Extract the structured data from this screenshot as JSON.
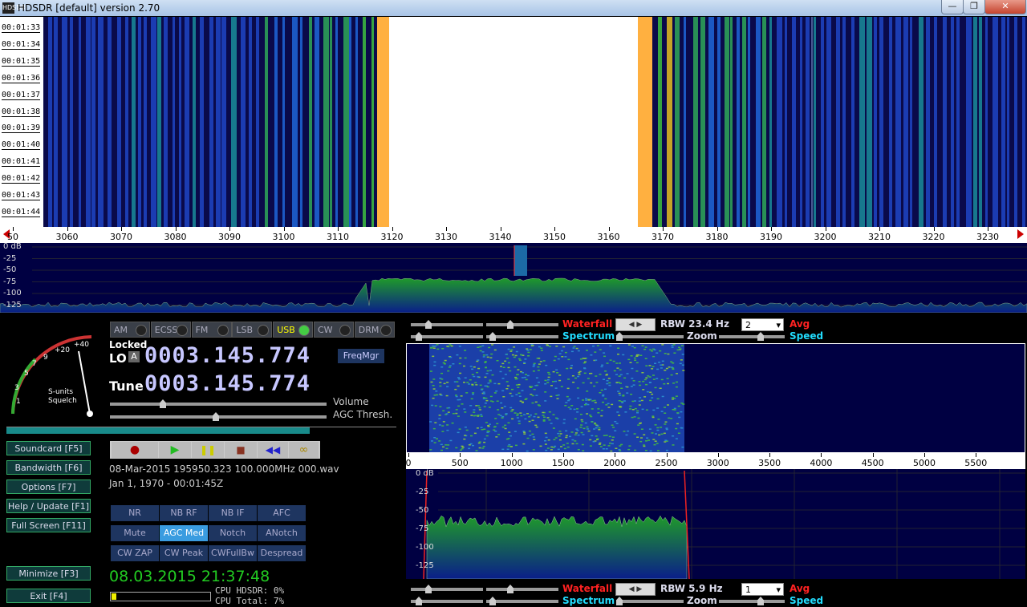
{
  "window": {
    "title": "HDSDR [default]  version 2.70",
    "minimize": "—",
    "restore": "❐",
    "close": "✕",
    "icon": "HDSDR"
  },
  "waterfall": {
    "times": [
      "00:01:33",
      "00:01:34",
      "00:01:35",
      "00:01:36",
      "00:01:37",
      "00:01:38",
      "00:01:39",
      "00:01:40",
      "00:01:41",
      "00:01:42",
      "00:01:43",
      "00:01:44"
    ]
  },
  "freq_axis": {
    "labels": [
      "50",
      "3060",
      "3070",
      "3080",
      "3090",
      "3100",
      "3110",
      "3120",
      "3130",
      "3140",
      "3150",
      "3160",
      "3170",
      "3180",
      "3190",
      "3200",
      "3210",
      "3220",
      "3230"
    ]
  },
  "spectrum": {
    "db_labels": [
      "0 dB",
      "-25",
      "-50",
      "-75",
      "-100",
      "-125"
    ]
  },
  "modes": [
    {
      "label": "AM",
      "active": false
    },
    {
      "label": "ECSS",
      "active": false
    },
    {
      "label": "FM",
      "active": false
    },
    {
      "label": "LSB",
      "active": false
    },
    {
      "label": "USB",
      "active": true
    },
    {
      "label": "CW",
      "active": false
    },
    {
      "label": "DRM",
      "active": false
    }
  ],
  "smeter": {
    "scale": [
      "1",
      "3",
      "5",
      "7",
      "9",
      "+20",
      "+40"
    ],
    "label1": "S-units",
    "label2": "Squelch"
  },
  "lo": {
    "locked": "Locked",
    "label": "LO",
    "a_badge": "A",
    "value": "0003.145.774"
  },
  "tune": {
    "label": "Tune",
    "value": "0003.145.774"
  },
  "freqmgr": "FreqMgr",
  "sliders": {
    "volume": "Volume",
    "agc": "AGC Thresh."
  },
  "side_buttons": [
    "Soundcard  [F5]",
    "Bandwidth  [F6]",
    "Options  [F7]",
    "Help / Update  [F1]",
    "Full Screen  [F11]",
    "Minimize  [F3]",
    "Exit  [F4]"
  ],
  "transport": {
    "record": "●",
    "play": "▶",
    "pause": "❚❚",
    "stop": "■",
    "rewind": "◀◀",
    "loop": "∞"
  },
  "file": {
    "name": "08-Mar-2015 195950.323 100.000MHz 000.wav",
    "time": "Jan 1, 1970 - 00:01:45Z"
  },
  "fn_buttons": [
    {
      "label": "NR",
      "active": false
    },
    {
      "label": "NB RF",
      "active": false
    },
    {
      "label": "NB IF",
      "active": false
    },
    {
      "label": "AFC",
      "active": false
    },
    {
      "label": "Mute",
      "active": false
    },
    {
      "label": "AGC Med",
      "active": true
    },
    {
      "label": "Notch",
      "active": false
    },
    {
      "label": "ANotch",
      "active": false
    },
    {
      "label": "CW ZAP",
      "active": false
    },
    {
      "label": "CW Peak",
      "active": false
    },
    {
      "label": "CWFullBw",
      "active": false
    },
    {
      "label": "Despread",
      "active": false
    }
  ],
  "datetime": "08.03.2015 21:37:48",
  "cpu": {
    "hdsdr": "CPU HDSDR:  0%",
    "total": "CPU Total:  7%"
  },
  "top_ctrl": {
    "waterfall": "Waterfall",
    "spectrum": "Spectrum",
    "rbw": "RBW 23.4 Hz",
    "avg_val": "2",
    "avg": "Avg",
    "zoom": "Zoom",
    "speed": "Speed"
  },
  "bottom_ctrl": {
    "waterfall": "Waterfall",
    "spectrum": "Spectrum",
    "rbw": "RBW  5.9 Hz",
    "avg_val": "1",
    "avg": "Avg",
    "zoom": "Zoom",
    "speed": "Speed"
  },
  "zoom_axis": {
    "labels": [
      "0",
      "500",
      "1000",
      "1500",
      "2000",
      "2500",
      "3000",
      "3500",
      "4000",
      "4500",
      "5000",
      "5500"
    ]
  },
  "zoom_spec": {
    "db_labels": [
      "0 dB",
      "-25",
      "-50",
      "-75",
      "-100",
      "-125"
    ]
  }
}
